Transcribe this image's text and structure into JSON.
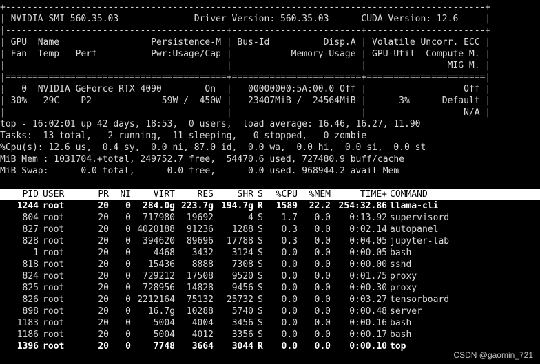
{
  "smi": {
    "border_top": "+-----------------------------------------------------------------------------------------+",
    "title_row": "| NVIDIA-SMI 560.35.03              Driver Version: 560.35.03      CUDA Version: 12.6     |",
    "sep1": "|-----------------------------------------+------------------------+----------------------+",
    "header_row1": "| GPU  Name                 Persistence-M | Bus-Id          Disp.A | Volatile Uncorr. ECC |",
    "header_row2": "| Fan  Temp   Perf          Pwr:Usage/Cap |           Memory-Usage | GPU-Util  Compute M. |",
    "header_row3": "|                                         |                        |               MIG M. |",
    "sep2": "|=========================================+========================+======================|",
    "gpu_row1": "|   0  NVIDIA GeForce RTX 4090        On  |   00000000:5A:00.0 Off |                  Off |",
    "gpu_row2": "| 30%   29C    P2             59W /  450W |   23407MiB /  24564MiB |      3%      Default |",
    "gpu_row3": "|                                         |                        |                  N/A |"
  },
  "top": {
    "line1": "top - 16:02:01 up 42 days, 18:53,  0 users,  load average: 16.46, 16.27, 11.90",
    "tasks": "Tasks:  13 total,   2 running,  11 sleeping,   0 stopped,   0 zombie",
    "cpu": "%Cpu(s): 12.6 us,  0.4 sy,  0.0 ni, 87.0 id,  0.0 wa,  0.0 hi,  0.0 si,  0.0 st",
    "mem": "MiB Mem : 1031704.+total, 249752.7 free,  54470.6 used, 727480.9 buff/cache",
    "swap": "MiB Swap:      0.0 total,      0.0 free,      0.0 used. 968944.2 avail Mem"
  },
  "columns": [
    "PID",
    "USER",
    "PR",
    "NI",
    "VIRT",
    "RES",
    "SHR",
    "S",
    "%CPU",
    "%MEM",
    "TIME+",
    "COMMAND"
  ],
  "processes": [
    {
      "pid": "1244",
      "user": "root",
      "pr": "20",
      "ni": "0",
      "virt": "284.0g",
      "res": "223.7g",
      "shr": "194.7g",
      "s": "R",
      "cpu": "1589",
      "mem": "22.2",
      "time": "254:32.86",
      "cmd": "llama-cli",
      "bold": true
    },
    {
      "pid": "804",
      "user": "root",
      "pr": "20",
      "ni": "0",
      "virt": "717980",
      "res": "19692",
      "shr": "4",
      "s": "S",
      "cpu": "1.7",
      "mem": "0.0",
      "time": "0:13.92",
      "cmd": "supervisord",
      "bold": false
    },
    {
      "pid": "827",
      "user": "root",
      "pr": "20",
      "ni": "0",
      "virt": "4020188",
      "res": "91236",
      "shr": "1288",
      "s": "S",
      "cpu": "0.3",
      "mem": "0.0",
      "time": "0:02.14",
      "cmd": "autopanel",
      "bold": false
    },
    {
      "pid": "828",
      "user": "root",
      "pr": "20",
      "ni": "0",
      "virt": "394620",
      "res": "89696",
      "shr": "17788",
      "s": "S",
      "cpu": "0.3",
      "mem": "0.0",
      "time": "0:04.05",
      "cmd": "jupyter-lab",
      "bold": false
    },
    {
      "pid": "1",
      "user": "root",
      "pr": "20",
      "ni": "0",
      "virt": "4468",
      "res": "3432",
      "shr": "3124",
      "s": "S",
      "cpu": "0.0",
      "mem": "0.0",
      "time": "0:00.05",
      "cmd": "bash",
      "bold": false
    },
    {
      "pid": "818",
      "user": "root",
      "pr": "20",
      "ni": "0",
      "virt": "15436",
      "res": "8888",
      "shr": "7308",
      "s": "S",
      "cpu": "0.0",
      "mem": "0.0",
      "time": "0:00.00",
      "cmd": "sshd",
      "bold": false
    },
    {
      "pid": "824",
      "user": "root",
      "pr": "20",
      "ni": "0",
      "virt": "729212",
      "res": "17508",
      "shr": "9520",
      "s": "S",
      "cpu": "0.0",
      "mem": "0.0",
      "time": "0:01.75",
      "cmd": "proxy",
      "bold": false
    },
    {
      "pid": "825",
      "user": "root",
      "pr": "20",
      "ni": "0",
      "virt": "728956",
      "res": "14828",
      "shr": "9456",
      "s": "S",
      "cpu": "0.0",
      "mem": "0.0",
      "time": "0:00.30",
      "cmd": "proxy",
      "bold": false
    },
    {
      "pid": "826",
      "user": "root",
      "pr": "20",
      "ni": "0",
      "virt": "2212164",
      "res": "75132",
      "shr": "25732",
      "s": "S",
      "cpu": "0.0",
      "mem": "0.0",
      "time": "0:03.27",
      "cmd": "tensorboard",
      "bold": false
    },
    {
      "pid": "898",
      "user": "root",
      "pr": "20",
      "ni": "0",
      "virt": "16.7g",
      "res": "10288",
      "shr": "5740",
      "s": "S",
      "cpu": "0.0",
      "mem": "0.0",
      "time": "0:00.48",
      "cmd": "server",
      "bold": false
    },
    {
      "pid": "1183",
      "user": "root",
      "pr": "20",
      "ni": "0",
      "virt": "5004",
      "res": "4004",
      "shr": "3456",
      "s": "S",
      "cpu": "0.0",
      "mem": "0.0",
      "time": "0:00.16",
      "cmd": "bash",
      "bold": false
    },
    {
      "pid": "1186",
      "user": "root",
      "pr": "20",
      "ni": "0",
      "virt": "5004",
      "res": "4012",
      "shr": "3356",
      "s": "S",
      "cpu": "0.0",
      "mem": "0.0",
      "time": "0:00.17",
      "cmd": "bash",
      "bold": false
    },
    {
      "pid": "1396",
      "user": "root",
      "pr": "20",
      "ni": "0",
      "virt": "7748",
      "res": "3664",
      "shr": "3044",
      "s": "R",
      "cpu": "0.0",
      "mem": "0.0",
      "time": "0:00.10",
      "cmd": "top",
      "bold": true
    }
  ],
  "watermark": "CSDN @gaomin_721"
}
